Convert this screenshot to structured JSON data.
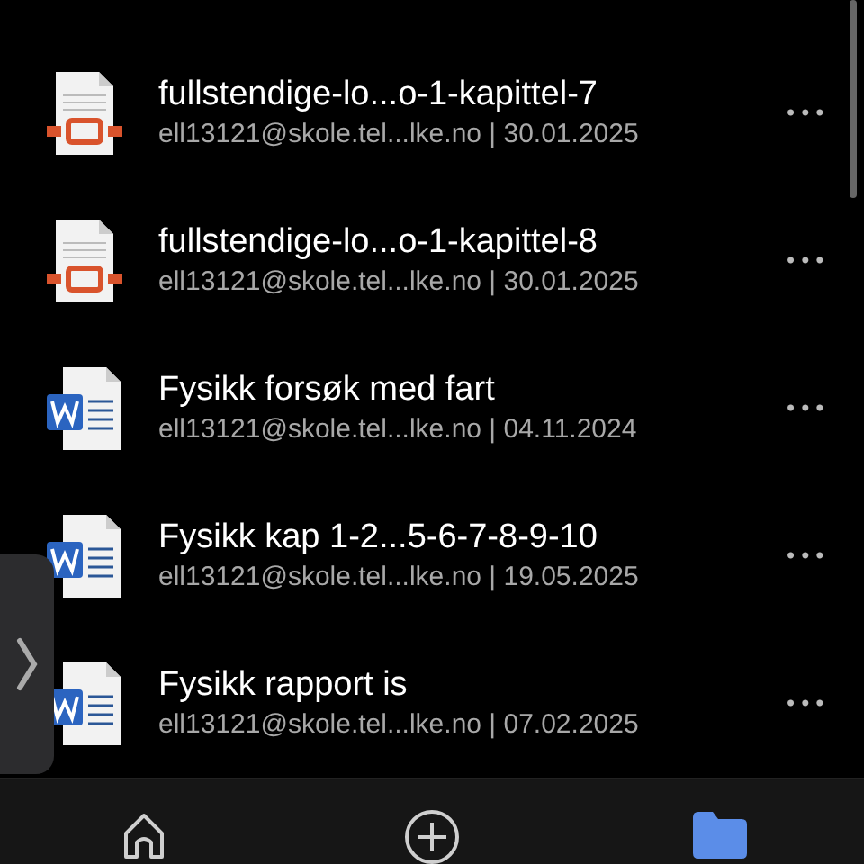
{
  "files": [
    {
      "kind": "pdf",
      "name": "fullstendige-lo...o-1-kapittel-7",
      "details": "ell13121@skole.tel...lke.no | 30.01.2025",
      "more": "•••"
    },
    {
      "kind": "pdf",
      "name": "fullstendige-lo...o-1-kapittel-8",
      "details": "ell13121@skole.tel...lke.no | 30.01.2025",
      "more": "•••"
    },
    {
      "kind": "word",
      "name": "Fysikk forsøk med fart",
      "details": "ell13121@skole.tel...lke.no | 04.11.2024",
      "more": "•••"
    },
    {
      "kind": "word",
      "name": "Fysikk kap 1-2...5-6-7-8-9-10",
      "details": "ell13121@skole.tel...lke.no | 19.05.2025",
      "more": "•••"
    },
    {
      "kind": "word",
      "name": "Fysikk rapport is",
      "details": "ell13121@skole.tel...lke.no | 07.02.2025",
      "more": "•••"
    }
  ],
  "tab_bar": [
    {
      "kind": "home",
      "selected": false
    },
    {
      "kind": "add",
      "selected": false
    },
    {
      "kind": "files",
      "selected": true
    }
  ]
}
